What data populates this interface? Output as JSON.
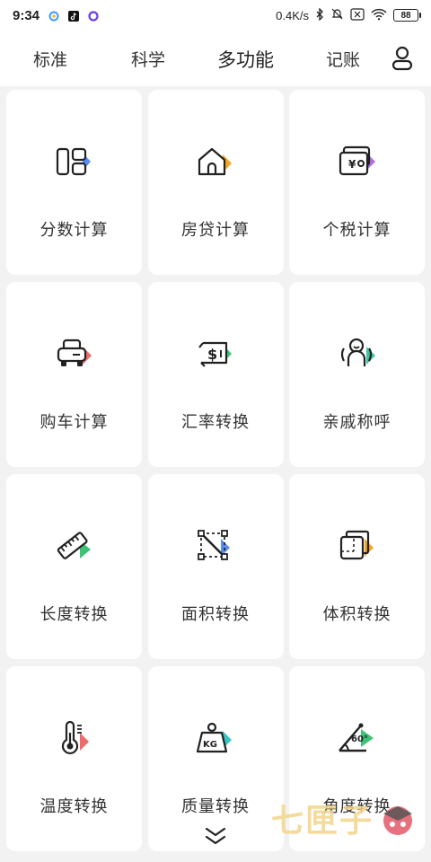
{
  "status_bar": {
    "time": "9:34",
    "network_speed": "0.4K/s",
    "battery": "88"
  },
  "tabs": [
    {
      "label": "标准"
    },
    {
      "label": "科学"
    },
    {
      "label": "多功能"
    },
    {
      "label": "记账"
    }
  ],
  "active_tab": "多功能",
  "functions": [
    {
      "label": "分数计算",
      "icon": "fraction-icon",
      "accent": "#5b8def"
    },
    {
      "label": "房贷计算",
      "icon": "house-icon",
      "accent": "#f5a623"
    },
    {
      "label": "个税计算",
      "icon": "tax-icon",
      "accent": "#b06de0"
    },
    {
      "label": "购车计算",
      "icon": "car-icon",
      "accent": "#ef6b6b"
    },
    {
      "label": "汇率转换",
      "icon": "exchange-icon",
      "accent": "#3cc476"
    },
    {
      "label": "亲戚称呼",
      "icon": "relatives-icon",
      "accent": "#3cc4a4"
    },
    {
      "label": "长度转换",
      "icon": "ruler-icon",
      "accent": "#3cc476"
    },
    {
      "label": "面积转换",
      "icon": "area-icon",
      "accent": "#5b8def"
    },
    {
      "label": "体积转换",
      "icon": "cube-icon",
      "accent": "#f5a623"
    },
    {
      "label": "温度转换",
      "icon": "thermometer-icon",
      "accent": "#ef6b6b"
    },
    {
      "label": "质量转换",
      "icon": "weight-icon",
      "accent": "#3cc4c4"
    },
    {
      "label": "角度转换",
      "icon": "angle-icon",
      "accent": "#3cc476"
    }
  ],
  "angle_icon_text": "60°",
  "weight_icon_text": "KG",
  "watermark": {
    "text": "七匣子"
  }
}
